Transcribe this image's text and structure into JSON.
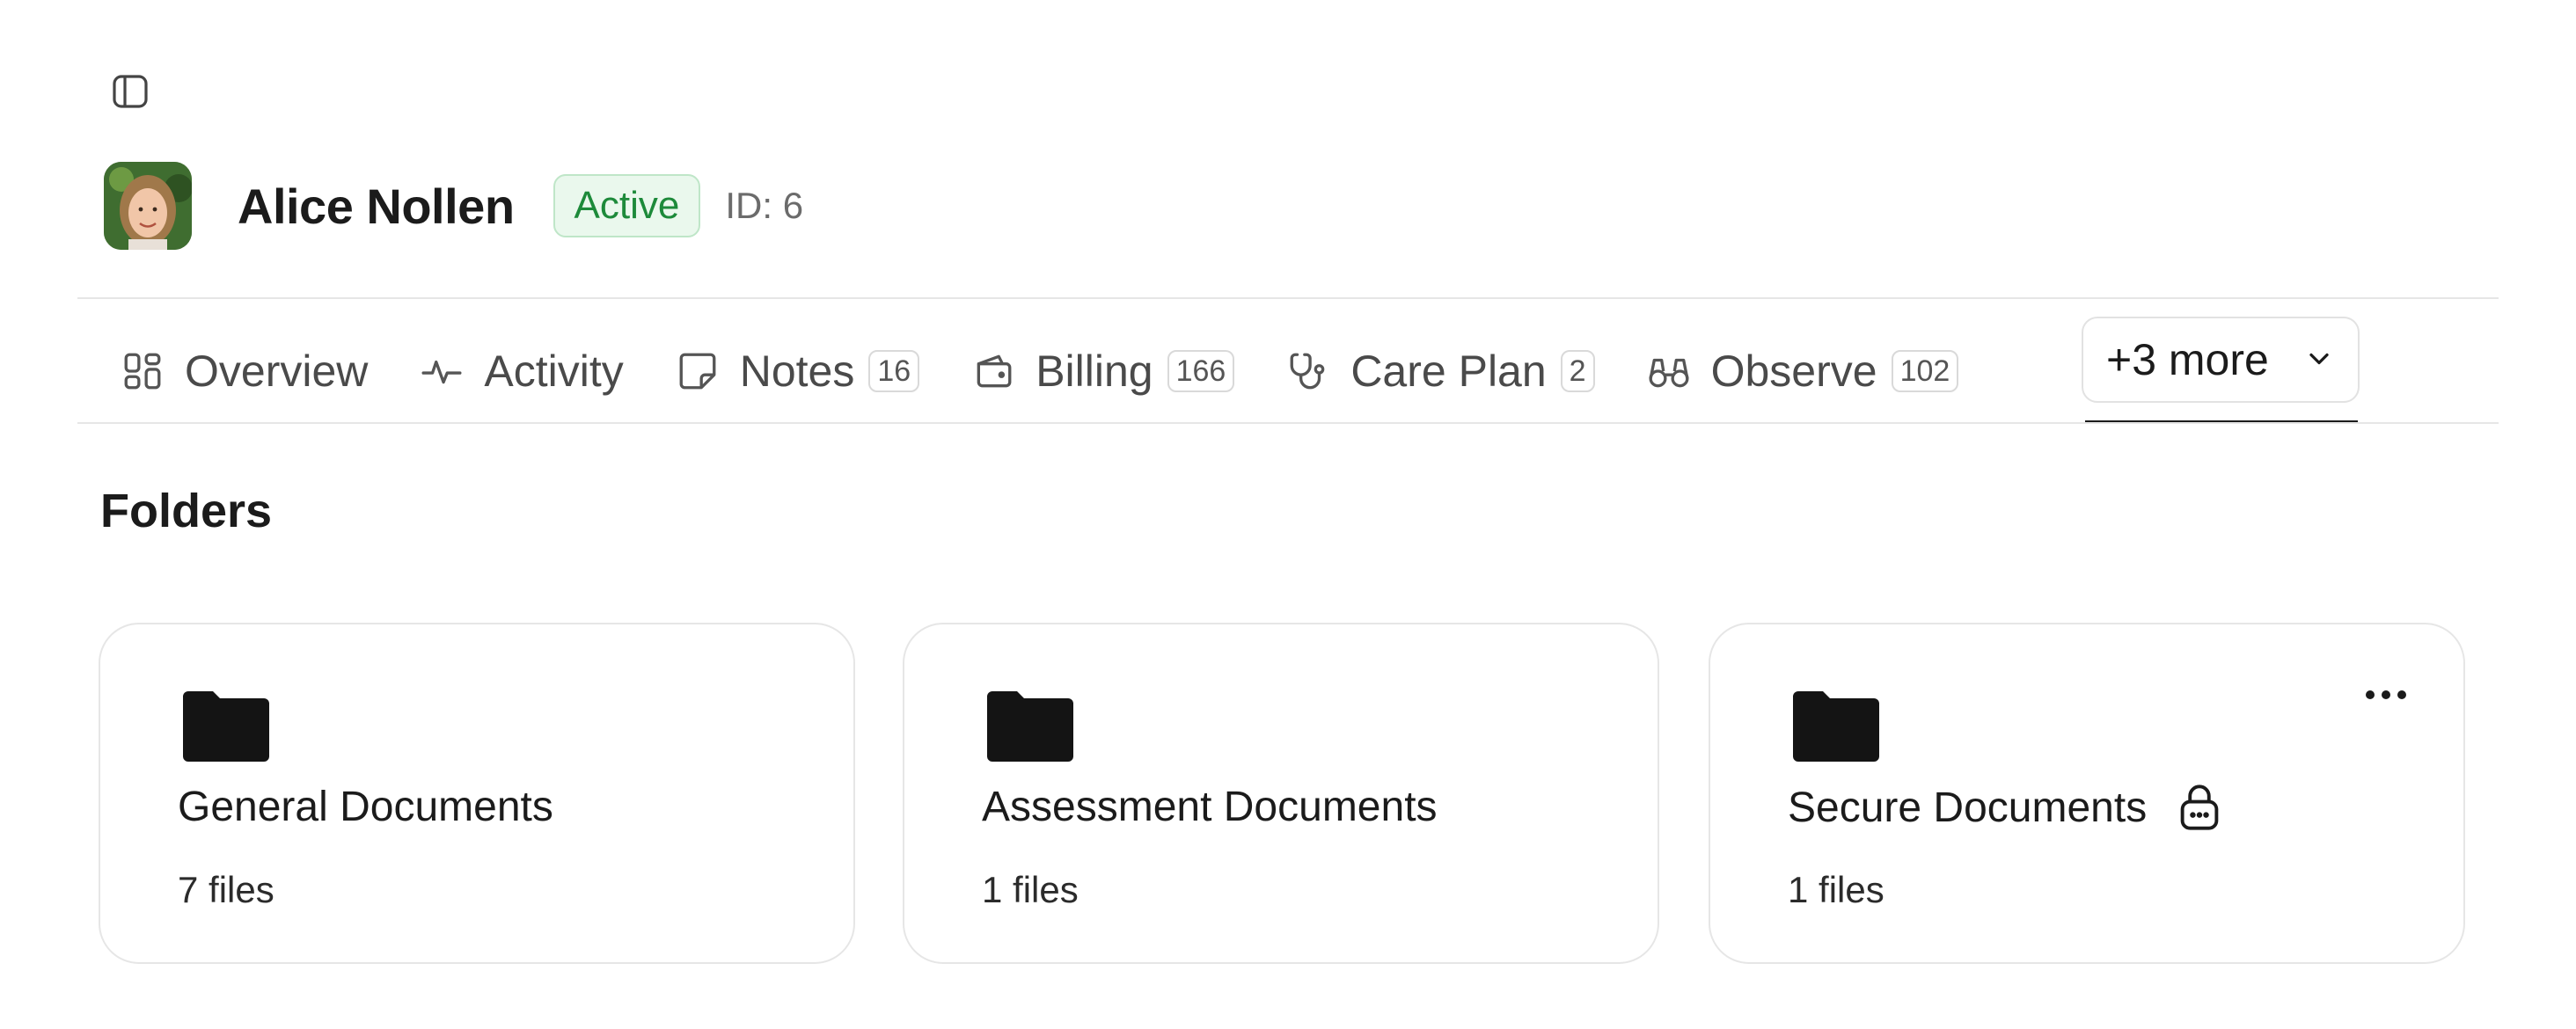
{
  "patient": {
    "name": "Alice Nollen",
    "status": "Active",
    "id_label": "ID: 6"
  },
  "tabs": [
    {
      "label": "Overview",
      "icon": "grid-icon",
      "count": ""
    },
    {
      "label": "Activity",
      "icon": "activity-icon",
      "count": ""
    },
    {
      "label": "Notes",
      "icon": "note-icon",
      "count": "16"
    },
    {
      "label": "Billing",
      "icon": "wallet-icon",
      "count": "166"
    },
    {
      "label": "Care Plan",
      "icon": "stethoscope-icon",
      "count": "2"
    },
    {
      "label": "Observe",
      "icon": "binoculars-icon",
      "count": "102"
    }
  ],
  "more_tab": {
    "label": "+3 more"
  },
  "section": {
    "title": "Folders"
  },
  "folders": [
    {
      "name": "General Documents",
      "count": "7 files",
      "locked": false
    },
    {
      "name": "Assessment Documents",
      "count": "1 files",
      "locked": false
    },
    {
      "name": "Secure Documents",
      "count": "1 files",
      "locked": true
    }
  ],
  "colors": {
    "status_bg": "#eaf8ed",
    "status_text": "#1d8a3a",
    "border": "#e6e6e6"
  }
}
